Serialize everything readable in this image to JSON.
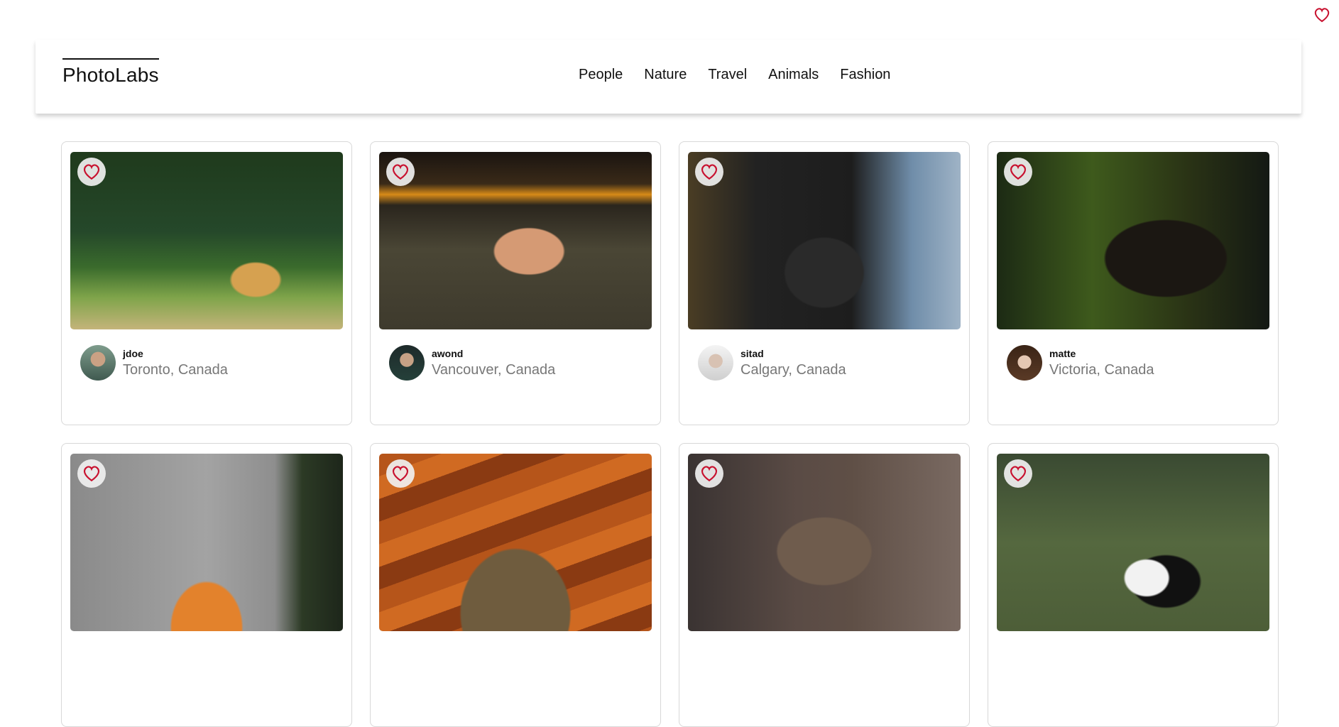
{
  "app": {
    "logo": "PhotoLabs"
  },
  "nav": {
    "topics": [
      "People",
      "Nature",
      "Travel",
      "Animals",
      "Fashion"
    ]
  },
  "colors": {
    "accent": "#c8102e"
  },
  "icons": {
    "favorite": "heart-icon"
  },
  "photos": [
    {
      "user": {
        "username": "jdoe",
        "location": "Toronto, Canada"
      }
    },
    {
      "user": {
        "username": "awond",
        "location": "Vancouver, Canada"
      }
    },
    {
      "user": {
        "username": "sitad",
        "location": "Calgary, Canada"
      }
    },
    {
      "user": {
        "username": "matte",
        "location": "Victoria, Canada"
      }
    },
    {
      "user": {
        "username": "",
        "location": ""
      }
    },
    {
      "user": {
        "username": "",
        "location": ""
      }
    },
    {
      "user": {
        "username": "",
        "location": ""
      }
    },
    {
      "user": {
        "username": "",
        "location": ""
      }
    }
  ]
}
